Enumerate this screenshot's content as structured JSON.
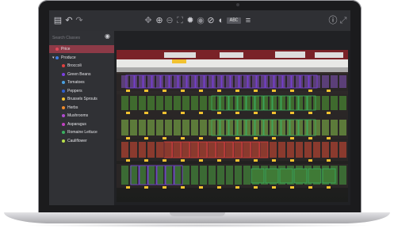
{
  "toolbar": {
    "icons": [
      "sidebar-toggle-icon",
      "undo-icon",
      "redo-icon",
      "move-icon",
      "zoom-in-icon",
      "zoom-out-icon",
      "fit-screen-icon",
      "settings-icon",
      "brightness-icon",
      "hide-icon",
      "contrast-icon",
      "label-icon",
      "menu-icon",
      "info-icon",
      "expand-icon"
    ],
    "label_badge": "ABC"
  },
  "sidebar": {
    "search_placeholder": "Search Classes",
    "classes": [
      {
        "label": "Price",
        "color": "#e04a5a",
        "selected": true
      },
      {
        "label": "Produce",
        "color": "#3e7be0",
        "group": true
      },
      {
        "label": "Broccoli",
        "color": "#e04040"
      },
      {
        "label": "Green Beans",
        "color": "#7a3fe0"
      },
      {
        "label": "Tomatoes",
        "color": "#4aa0e0"
      },
      {
        "label": "Peppers",
        "color": "#2f5fd0"
      },
      {
        "label": "Brussels Sprouts",
        "color": "#f2c230"
      },
      {
        "label": "Herbs",
        "color": "#f08a2a"
      },
      {
        "label": "Mushrooms",
        "color": "#b04ad0"
      },
      {
        "label": "Asparagus",
        "color": "#c040c0"
      },
      {
        "label": "Romaine Lettuce",
        "color": "#3ab060"
      },
      {
        "label": "Cauliflower",
        "color": "#b8e04a"
      }
    ]
  },
  "colors": {
    "price": "#f2c230",
    "green_beans": "#7a3fe0",
    "broccoli": "#e04040",
    "romaine": "#3ab060"
  }
}
